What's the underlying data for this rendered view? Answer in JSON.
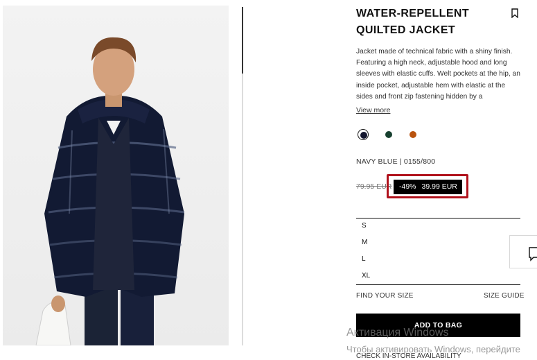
{
  "product": {
    "title": "WATER-REPELLENT QUILTED JACKET",
    "description": "Jacket made of technical fabric with a shiny finish. Featuring a high neck, adjustable hood and long sleeves with elastic cuffs. Welt pockets at the hip, an inside pocket, adjustable hem with elastic at the sides and front zip fastening hidden by a",
    "view_more": "View more",
    "colors": [
      {
        "name": "navy",
        "hex": "#13162e",
        "selected": true
      },
      {
        "name": "dark-green",
        "hex": "#17402f",
        "selected": false
      },
      {
        "name": "orange",
        "hex": "#b9530f",
        "selected": false
      }
    ],
    "color_label": "NAVY BLUE | 0155/800",
    "price": {
      "old": "79.95 EUR",
      "discount": "-49%",
      "current": "39.99 EUR"
    },
    "sizes": [
      "S",
      "M",
      "L",
      "XL"
    ],
    "find_your_size": "FIND YOUR SIZE",
    "size_guide": "SIZE GUIDE",
    "add_to_bag": "ADD TO BAG",
    "store_availability": "CHECK IN-STORE AVAILABILITY"
  },
  "icons": {
    "bookmark": "bookmark-icon",
    "chat": "chat-icon"
  },
  "watermark": {
    "title": "Активация Windows",
    "subtitle": "Чтобы активировать Windows, перейдите"
  },
  "colors": {
    "highlight_border": "#b0121c",
    "button_bg": "#000000"
  }
}
